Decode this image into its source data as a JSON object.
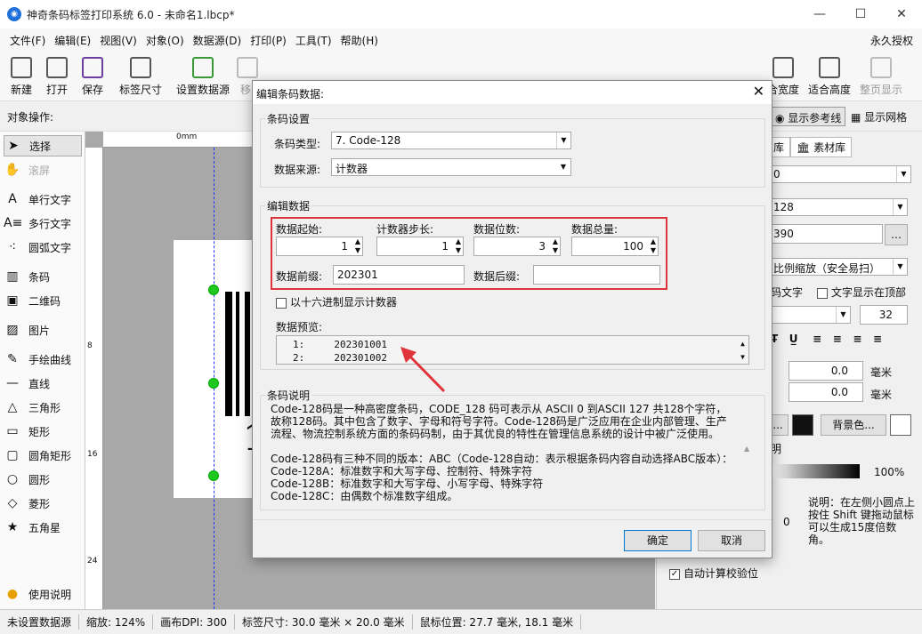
{
  "window": {
    "title": "神奇条码标签打印系统 6.0 - 未命名1.lbcp*",
    "min": "—",
    "max": "☐",
    "close": "✕",
    "logo": "◉"
  },
  "menu": {
    "items": [
      "文件(F)",
      "编辑(E)",
      "视图(V)",
      "对象(O)",
      "数据源(D)",
      "打印(P)",
      "工具(T)",
      "帮助(H)"
    ],
    "license": "永久授权"
  },
  "toolbar": {
    "new": "新建",
    "open": "打开",
    "save": "保存",
    "label_size": "标签尺寸",
    "set_datasource": "设置数据源",
    "remove": "移",
    "fit_width": "合宽度",
    "fit_height": "适合高度",
    "whole_page": "整页显示"
  },
  "objbar": {
    "label": "对象操作:",
    "show_ref": "显示参考线",
    "show_grid": "显示网格"
  },
  "tools": [
    "选择",
    "滚屏",
    "单行文字",
    "多行文字",
    "圆弧文字",
    "条码",
    "二维码",
    "图片",
    "手绘曲线",
    "直线",
    "三角形",
    "矩形",
    "圆角矩形",
    "圆形",
    "菱形",
    "五角星",
    "使用说明"
  ],
  "ruler": {
    "h0": "0mm",
    "v8": "8",
    "v16": "16",
    "v24": "24"
  },
  "canvas": {
    "label_text": "1"
  },
  "right": {
    "tab1": "库",
    "tab2": "素材库",
    "combo1": "0",
    "combo2": "128",
    "field1": "390",
    "scale": "比例缩放（安全易扫）",
    "code_text": "码文字",
    "text_top": "文字显示在顶部",
    "font_size": "32",
    "v1": "0.0",
    "unit1": "毫米",
    "v2": "0.0",
    "unit2": "毫米",
    "fg_btn": "...",
    "bg_btn": "背景色...",
    "ming": "明",
    "pct": "100%",
    "zero": "0",
    "hint": "说明：在左侧小圆点上按住 Shift 键拖动鼠标可以生成15度倍数角。",
    "auto_check": "自动计算校验位"
  },
  "status": {
    "datasource": "未设置数据源",
    "zoom": "缩放: 124%",
    "dpi": "画布DPI: 300",
    "size": "标签尺寸: 30.0 毫米 × 20.0 毫米",
    "mouse": "鼠标位置: 27.7 毫米, 18.1 毫米"
  },
  "dialog": {
    "title": "编辑条码数据:",
    "barcode_settings": "条码设置",
    "type_label": "条码类型:",
    "type_value": "7. Code-128",
    "source_label": "数据来源:",
    "source_value": "计数器",
    "edit_data": "编辑数据",
    "start_label": "数据起始:",
    "start_value": "1",
    "step_label": "计数器步长:",
    "step_value": "1",
    "digits_label": "数据位数:",
    "digits_value": "3",
    "total_label": "数据总量:",
    "total_value": "100",
    "prefix_label": "数据前缀:",
    "prefix_value": "202301",
    "suffix_label": "数据后缀:",
    "suffix_value": "",
    "hex_label": "以十六进制显示计数器",
    "preview_label": "数据预览:",
    "preview_rows": [
      "1:     202301001",
      "2:     202301002"
    ],
    "desc_title": "条码说明",
    "desc_text": "Code-128码是一种高密度条码，CODE_128 码可表示从 ASCII 0 到ASCII 127 共128个字符，故称128码。其中包含了数字、字母和符号字符。Code-128码是广泛应用在企业内部管理、生产流程、物流控制系统方面的条码码制，由于其优良的特性在管理信息系统的设计中被广泛使用。\n\nCode-128码有三种不同的版本：ABC（Code-128自动：表示根据条码内容自动选择ABC版本）：\nCode-128A：标准数字和大写字母、控制符、特殊字符\nCode-128B：标准数字和大写字母、小写字母、特殊字符\nCode-128C：由偶数个标准数字组成。",
    "ok": "确定",
    "cancel": "取消"
  },
  "colors": {
    "highlight": "#e0343c",
    "accent": "#1e6fd9"
  }
}
